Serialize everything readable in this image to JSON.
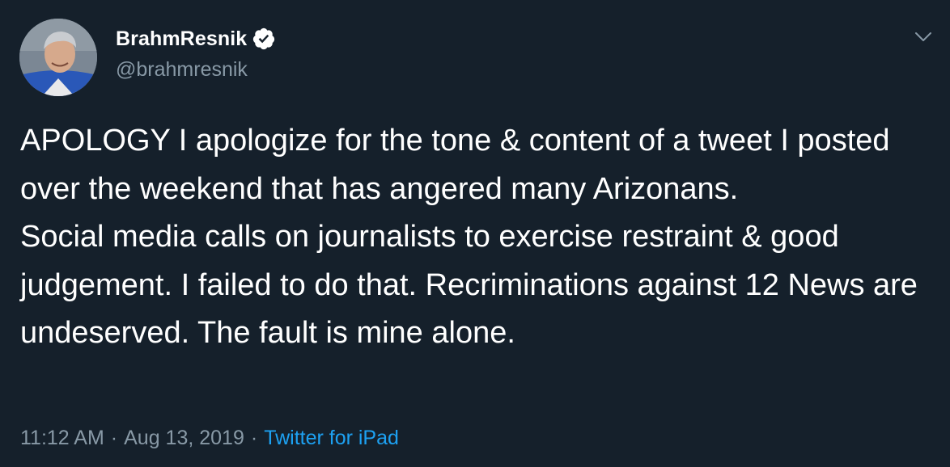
{
  "user": {
    "display_name": "BrahmResnik",
    "handle": "@brahmresnik",
    "verified_icon": "verified-badge-icon"
  },
  "tweet": {
    "text": "APOLOGY I apologize for the tone & content of a tweet I posted over the weekend that has angered many Arizonans.\nSocial media calls on journalists to exercise restraint & good judgement. I failed to do that. Recriminations against 12 News are undeserved. The fault is mine alone."
  },
  "meta": {
    "time": "11:12 AM",
    "separator": "·",
    "date": "Aug 13, 2019",
    "source": "Twitter for iPad"
  },
  "icons": {
    "menu": "chevron-down-icon"
  },
  "colors": {
    "background": "#15202b",
    "secondary_text": "#8899a6",
    "link": "#1da1f2"
  }
}
